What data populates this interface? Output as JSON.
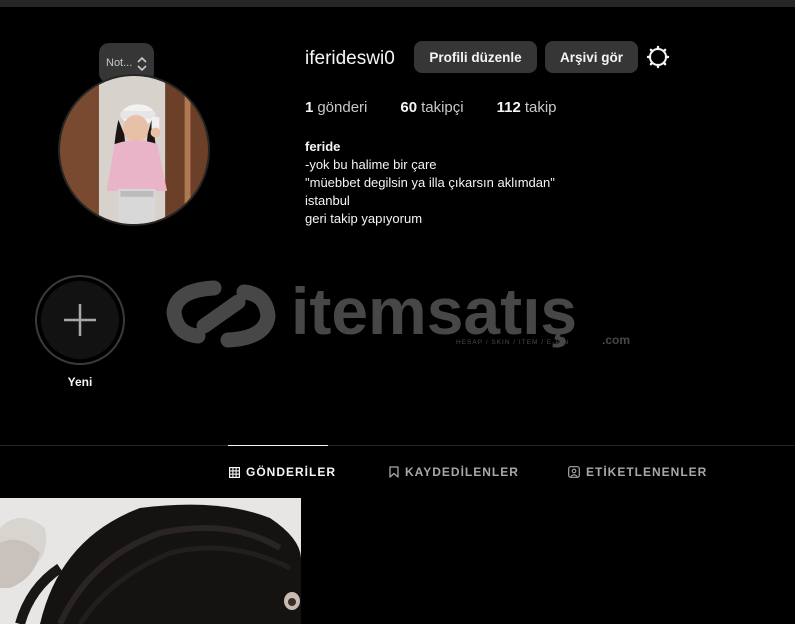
{
  "note": {
    "text": "Not..."
  },
  "profile": {
    "username": "iferideswi0",
    "edit_button": "Profili düzenle",
    "archive_button": "Arşivi gör"
  },
  "stats": {
    "posts_count": "1",
    "posts_label": "gönderi",
    "followers_count": "60",
    "followers_label": "takipçi",
    "following_count": "112",
    "following_label": "takip"
  },
  "bio": {
    "name": "feride",
    "lines": [
      "-yok bu halime bir çare",
      "\"müebbet degilsin ya illa çıkarsın aklımdan\"",
      "istanbul",
      "geri takip yapıyorum"
    ]
  },
  "highlights": {
    "new_label": "Yeni"
  },
  "watermark": {
    "brand": "itemsatış",
    "tagline": "HESAP / SKIN / ITEM / E-PIN",
    "suffix": ".com"
  },
  "tabs": [
    {
      "label": "GÖNDERİLER",
      "icon": "grid-icon",
      "active": true
    },
    {
      "label": "KAYDEDİLENLER",
      "icon": "bookmark-icon",
      "active": false
    },
    {
      "label": "ETİKETLENENLER",
      "icon": "tag-person-icon",
      "active": false
    }
  ],
  "colors": {
    "background": "#000000",
    "button": "#363636",
    "text": "#f5f5f5",
    "muted": "#a8a8a8"
  }
}
